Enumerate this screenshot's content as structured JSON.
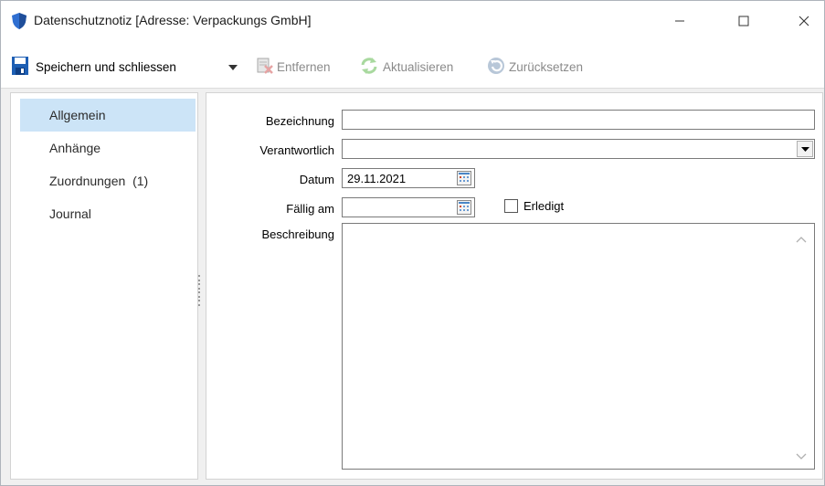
{
  "window": {
    "title": "Datenschutznotiz [Adresse: Verpackungs GmbH]",
    "icon": "shield-icon",
    "controls": [
      "minimize",
      "maximize",
      "close"
    ]
  },
  "toolbar": {
    "save_label": "Speichern und schliessen",
    "remove_label": "Entfernen",
    "refresh_label": "Aktualisieren",
    "reset_label": "Zurücksetzen"
  },
  "nav": {
    "items": [
      {
        "label": "Allgemein",
        "active": true
      },
      {
        "label": "Anhänge",
        "active": false
      },
      {
        "label": "Zuordnungen  (1)",
        "active": false
      },
      {
        "label": "Journal",
        "active": false
      }
    ]
  },
  "form": {
    "bezeichnung": {
      "label": "Bezeichnung",
      "value": ""
    },
    "verantwortlich": {
      "label": "Verantwortlich",
      "value": ""
    },
    "datum": {
      "label": "Datum",
      "value": "29.11.2021"
    },
    "faellig": {
      "label": "Fällig am",
      "value": ""
    },
    "erledigt": {
      "label": "Erledigt",
      "checked": false
    },
    "beschreibung": {
      "label": "Beschreibung",
      "value": ""
    }
  },
  "colors": {
    "accent": "#cce4f7",
    "save_icon": "#1e5fb4",
    "disabled_text": "#8a8a8a"
  }
}
